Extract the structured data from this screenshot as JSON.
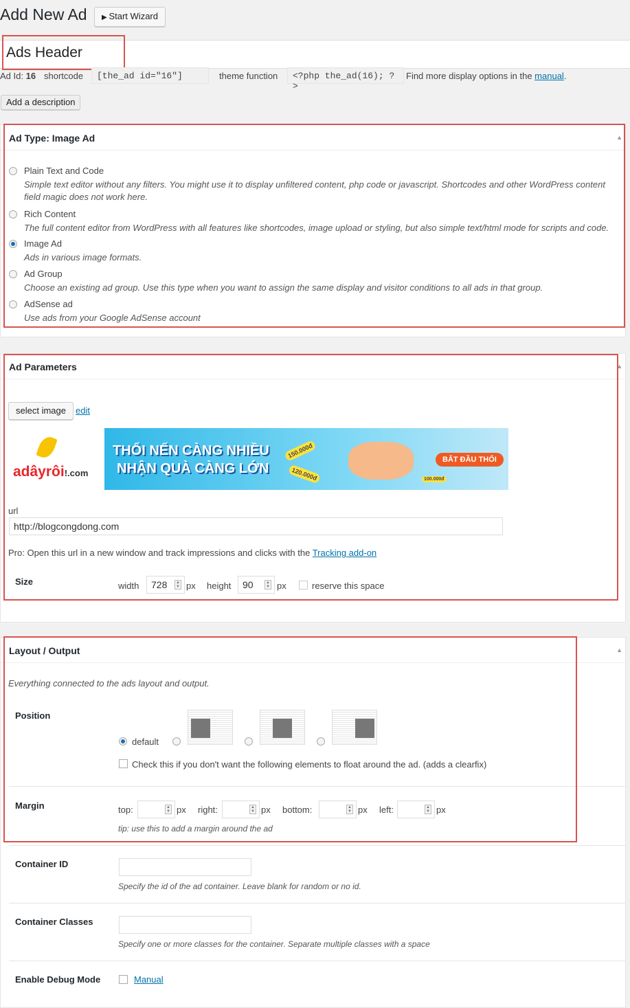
{
  "header": {
    "title": "Add New Ad",
    "wizard_label": "Start Wizard"
  },
  "ad_title": "Ads Header",
  "meta": {
    "ad_id_label": "Ad Id:",
    "ad_id": "16",
    "shortcode_label": "shortcode",
    "shortcode": "[the_ad id=\"16\"]",
    "theme_function_label": "theme function",
    "theme_function": "<?php the_ad(16); ?>",
    "more_text": "Find more display options in the",
    "manual_link": "manual",
    "period": "."
  },
  "add_description": "Add a description",
  "ad_type": {
    "title": "Ad Type: Image Ad",
    "options": [
      {
        "label": "Plain Text and Code",
        "desc": "Simple text editor without any filters. You might use it to display unfiltered content, php code or javascript. Shortcodes and other WordPress content field magic does not work here.",
        "checked": false
      },
      {
        "label": "Rich Content",
        "desc": "The full content editor from WordPress with all features like shortcodes, image upload or styling, but also simple text/html mode for scripts and code.",
        "checked": false
      },
      {
        "label": "Image Ad",
        "desc": "Ads in various image formats.",
        "checked": true
      },
      {
        "label": "Ad Group",
        "desc": "Choose an existing ad group. Use this type when you want to assign the same display and visitor conditions to all ads in that group.",
        "checked": false
      },
      {
        "label": "AdSense ad",
        "desc": "Use ads from your Google AdSense account",
        "checked": false
      }
    ]
  },
  "params": {
    "title": "Ad Parameters",
    "select_image": "select image",
    "edit": "edit",
    "banner": {
      "logo": "adayroi!.com",
      "line1": "THỔI NẾN CÀNG NHIỀU",
      "line2": "NHẬN QUÀ CÀNG LỚN",
      "cta": "BẮT ĐẦU THỔI",
      "prices": [
        "150.000đ",
        "120.000đ",
        "100.000đ"
      ]
    },
    "url_label": "url",
    "url_value": "http://blogcongdong.com",
    "pro_text": "Pro: Open this url in a new window and track impressions and clicks with the",
    "pro_link": "Tracking add-on",
    "size_label": "Size",
    "width_label": "width",
    "width": "728",
    "px": "px",
    "height_label": "height",
    "height": "90",
    "reserve": "reserve this space"
  },
  "layout": {
    "title": "Layout / Output",
    "intro": "Everything connected to the ads layout and output.",
    "position_label": "Position",
    "default": "default",
    "clearfix": "Check this if you don't want the following elements to float around the ad. (adds a clearfix)",
    "margin_label": "Margin",
    "top": "top:",
    "right": "right:",
    "bottom": "bottom:",
    "left": "left:",
    "px": "px",
    "tip": "tip: use this to add a margin around the ad",
    "container_id_label": "Container ID",
    "container_id_help": "Specify the id of the ad container. Leave blank for random or no id.",
    "container_classes_label": "Container Classes",
    "container_classes_help": "Specify one or more classes for the container. Separate multiple classes with a space",
    "debug_label": "Enable Debug Mode",
    "debug_link": "Manual"
  },
  "colors": {
    "highlight": "#d9534f",
    "link": "#0073aa"
  }
}
